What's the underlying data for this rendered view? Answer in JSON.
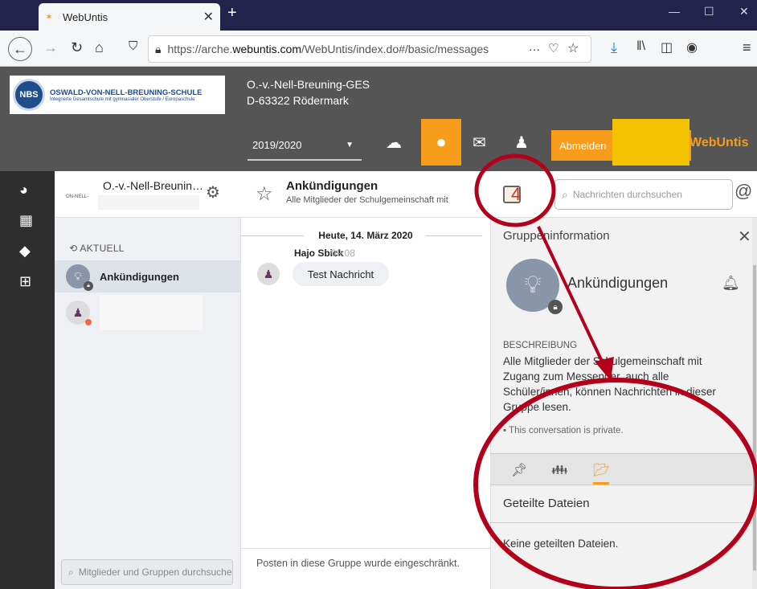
{
  "browser": {
    "tab_title": "WebUntis",
    "url_prefix": "https://arche.",
    "url_domain": "webuntis.com",
    "url_suffix": "/WebUntis/index.do#/basic/messages",
    "more": "···"
  },
  "school": {
    "logo_abbr": "NBS",
    "logo_name": "OSWALD-VON-NELL-BREUNING-SCHULE",
    "logo_sub": "Integrierte Gesamtschule mit gymnasialer Oberstufe / Europaschule",
    "name": "O.-v.-Nell-Breuning-GES",
    "address": "D-63322 Rödermark"
  },
  "header": {
    "year": "2019/2020",
    "logout": "Abmelden",
    "brand": "WebUntis"
  },
  "groups": {
    "header_name": "O.-v.-Nell-Breuning-GES",
    "header_mini": "ON-NELL-",
    "section": "AKTUELL",
    "items": [
      {
        "label": "Ankündigungen"
      },
      {
        "label": ""
      }
    ],
    "search_placeholder": "Mitglieder und Gruppen durchsuchen"
  },
  "chat": {
    "title": "Ankündigungen",
    "subtitle": "Alle Mitglieder der Schulgemeinschaft mit",
    "date": "Heute, 14. März 2020",
    "author": "Hajo Sbick",
    "time": "09:08",
    "message": "Test Nachricht",
    "footer": "Posten in diese Gruppe wurde eingeschränkt."
  },
  "info": {
    "search_placeholder": "Nachrichten durchsuchen",
    "title": "Gruppeninformation",
    "group_name": "Ankündigungen",
    "desc_heading": "BESCHREIBUNG",
    "description": "Alle Mitglieder der Schulgemeinschaft mit Zugang zum Messenger, auch alle Schüler/innen, können Nachrichten in dieser Gruppe lesen.",
    "private": "This conversation is private.",
    "files_heading": "Geteilte Dateien",
    "no_files": "Keine geteilten Dateien."
  },
  "annotation": {
    "number": "4",
    "color": "#b3001b"
  }
}
